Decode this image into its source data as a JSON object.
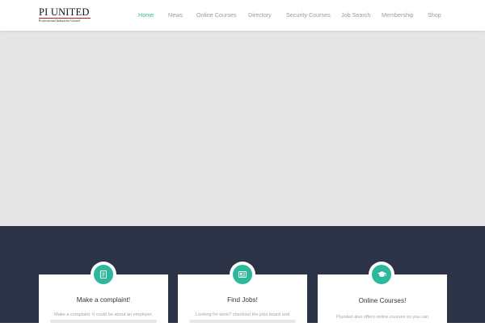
{
  "brand": {
    "title": "PI UNITED",
    "subtitle": "Professional Industries United"
  },
  "nav": {
    "items": [
      {
        "label": "Home",
        "active": true
      },
      {
        "label": "News",
        "active": false
      },
      {
        "label": "Online Courses",
        "active": false
      },
      {
        "label": "Directory",
        "active": false
      },
      {
        "label": "Security Courses",
        "active": false
      },
      {
        "label": "Job Search",
        "active": false
      },
      {
        "label": "Membership",
        "active": false
      },
      {
        "label": "Shop",
        "active": false
      }
    ]
  },
  "features": [
    {
      "title": "Make a complaint!",
      "icon": "notebook-icon",
      "text": "Make a complaint. It could be about an employer,"
    },
    {
      "title": "Find Jobs!",
      "icon": "newspaper-icon",
      "text": "Looking for work? checkout the jobs board and"
    },
    {
      "title": "Online Courses!",
      "icon": "graduation-cap-icon",
      "text": "PIunited also offers online courses so you can"
    }
  ],
  "colors": {
    "accent": "#2bb89b",
    "nav_text": "#9a9a9a",
    "hero_bg": "#e6e6e6",
    "section_bg": "#2c3347",
    "brand_rule": "#b32024"
  }
}
